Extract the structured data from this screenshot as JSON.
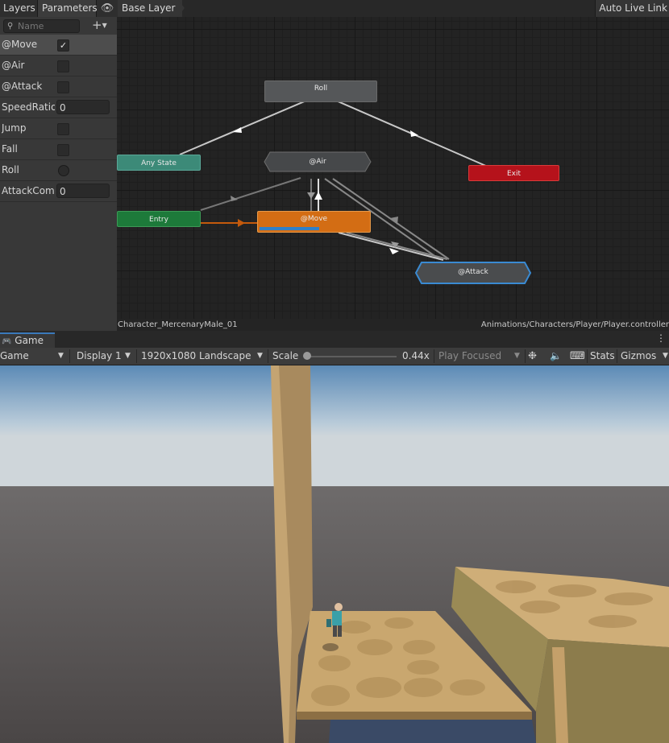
{
  "animator": {
    "tabs": {
      "layers": "Layers",
      "parameters": "Parameters"
    },
    "breadcrumb": "Base Layer",
    "auto_live_link": "Auto Live Link",
    "search": {
      "placeholder": "Name"
    },
    "parameters": [
      {
        "name": "@Move",
        "type": "bool",
        "value": true,
        "selected": true
      },
      {
        "name": "@Air",
        "type": "bool",
        "value": false
      },
      {
        "name": "@Attack",
        "type": "bool",
        "value": false
      },
      {
        "name": "SpeedRatio",
        "type": "float",
        "value": "0"
      },
      {
        "name": "Jump",
        "type": "bool",
        "value": false
      },
      {
        "name": "Fall",
        "type": "bool",
        "value": false
      },
      {
        "name": "Roll",
        "type": "trigger",
        "value": false
      },
      {
        "name": "AttackCombo",
        "type": "int",
        "value": "0"
      }
    ],
    "states": {
      "roll": "Roll",
      "any_state": "Any State",
      "air": "@Air",
      "exit": "Exit",
      "entry": "Entry",
      "move": "@Move",
      "attack": "@Attack"
    },
    "move_progress": 0.55,
    "footer_left": "Character_MercenaryMale_01",
    "footer_right": "Animations/Characters/Player/Player.controller"
  },
  "game": {
    "tab_label": "Game",
    "toolbar": {
      "mode": "Game",
      "display": "Display 1",
      "resolution": "1920x1080 Landscape",
      "scale_label": "Scale",
      "scale_value": "0.44x",
      "play_focused": "Play Focused",
      "stats": "Stats",
      "gizmos": "Gizmos"
    },
    "icons": [
      "gamepad-icon",
      "bug-icon",
      "speaker-icon",
      "keyboard-icon",
      "kebab-menu-icon"
    ]
  },
  "colors": {
    "entry": "#1d7a3a",
    "any_state": "#3c8a78",
    "exit": "#b5121b",
    "move": "#d36d14",
    "selected_tab_accent": "#3a79bb"
  }
}
